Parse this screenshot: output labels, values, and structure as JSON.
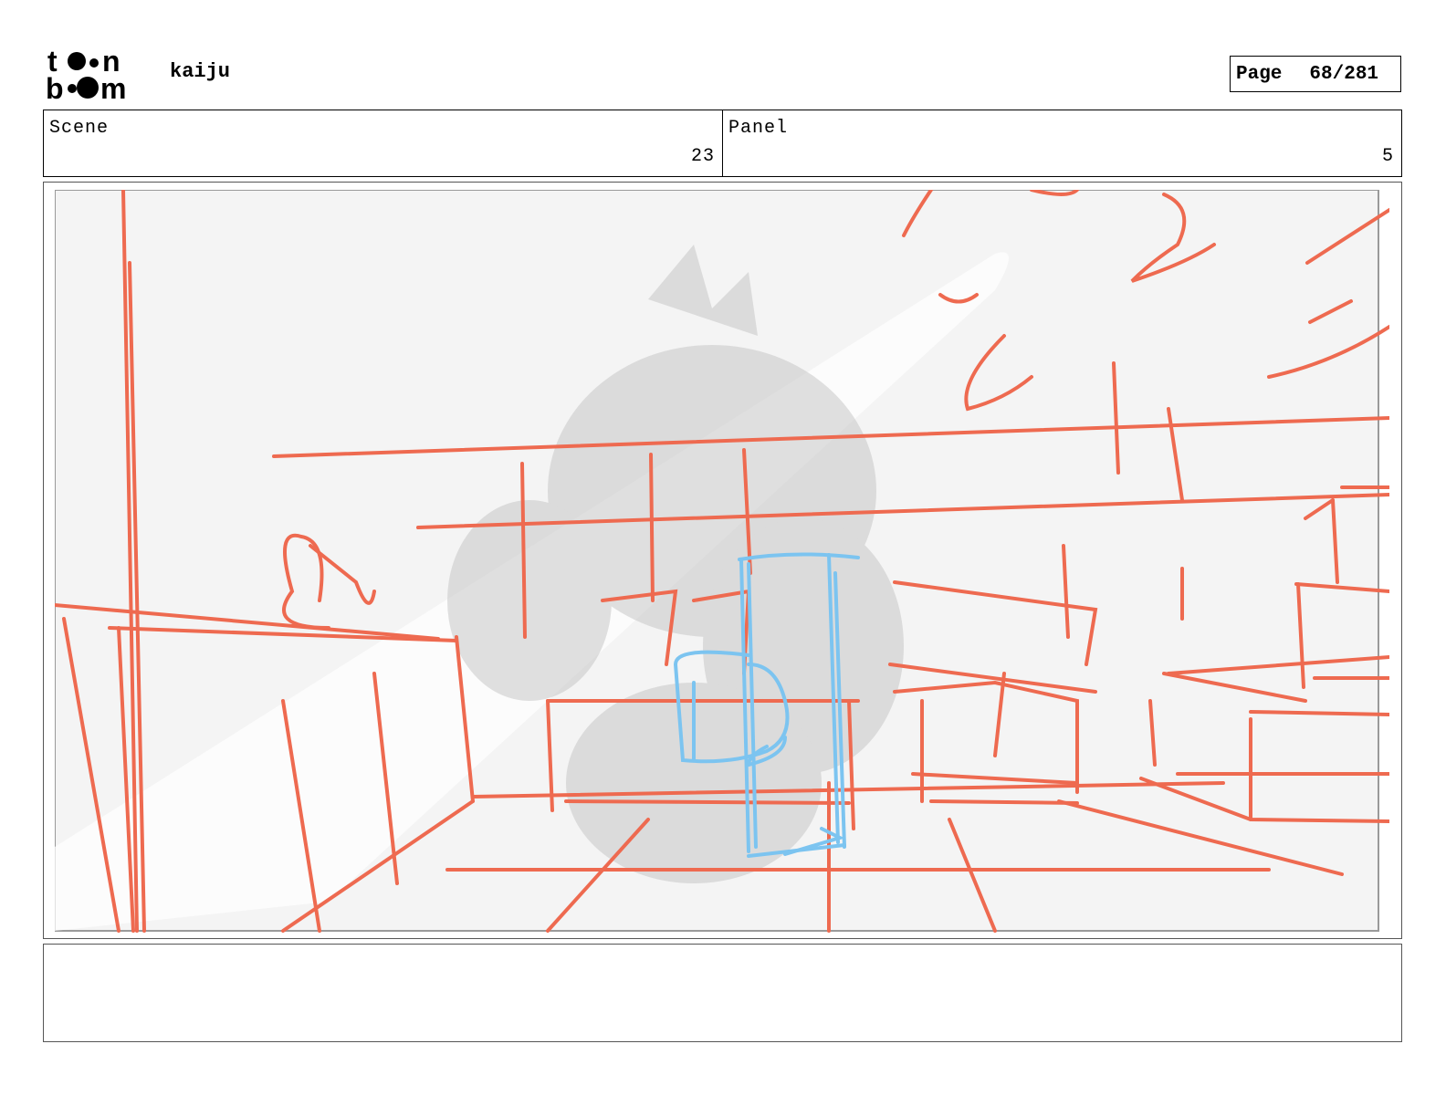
{
  "header": {
    "logo": {
      "line1": "toon",
      "line2": "boom"
    },
    "project_title": "kaiju",
    "page_label": "Page",
    "page_number": "68/281"
  },
  "info": {
    "scene_label": "Scene",
    "scene_value": "23",
    "panel_label": "Panel",
    "panel_value": "5"
  },
  "panel": {
    "sketch_colors": {
      "background": "#f4f4f4",
      "layout_lines": "#ee6a50",
      "character_lines": "#7cc4f0",
      "shadow": "#bdbdbd"
    }
  },
  "notes": {
    "text": ""
  }
}
